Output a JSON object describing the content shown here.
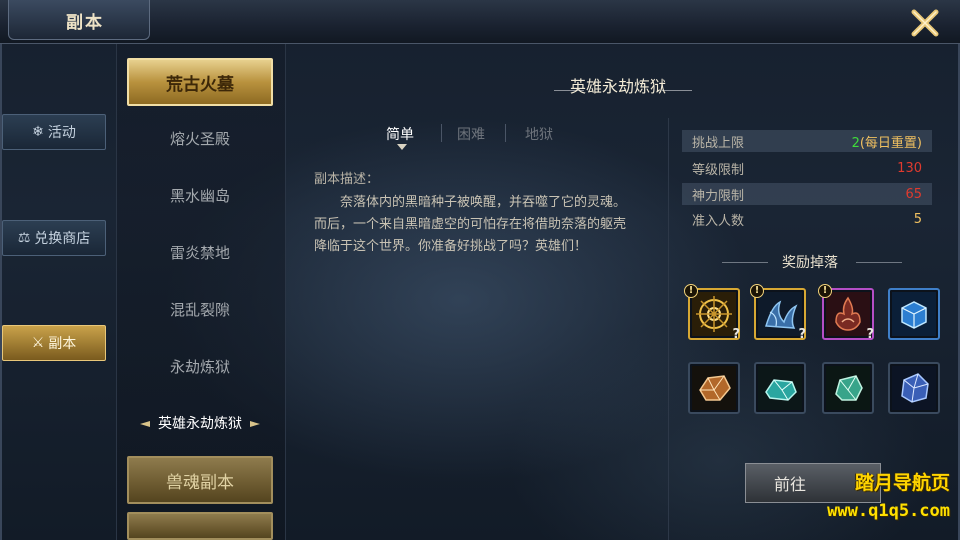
{
  "window": {
    "title": "副本"
  },
  "sidenav": [
    {
      "label": "活动",
      "icon": "snowflake-icon"
    },
    {
      "label": "兑换商店",
      "icon": "scale-icon"
    },
    {
      "label": "副本",
      "icon": "crossed-swords-icon"
    }
  ],
  "categories": [
    {
      "label": "荒古火墓"
    },
    {
      "label": "兽魂副本"
    }
  ],
  "dungeon_list": [
    "熔火圣殿",
    "黑水幽岛",
    "雷炎禁地",
    "混乱裂隙",
    "永劫炼狱",
    "英雄永劫炼狱"
  ],
  "detail": {
    "title": "英雄永劫炼狱",
    "difficulties": [
      "简单",
      "困难",
      "地狱"
    ],
    "desc_title": "副本描述：",
    "desc_body": "奈落体内的黑暗种子被唤醒，并吞噬了它的灵魂。而后，一个来自黑暗虚空的可怕存在将借助奈落的躯壳降临于这个世界。你准备好挑战了吗？英雄们！"
  },
  "stats": [
    {
      "label": "挑战上限",
      "value": "2(每日重置)",
      "value_prefix": "2",
      "value_suffix": "(每日重置)"
    },
    {
      "label": "等级限制",
      "value": "130"
    },
    {
      "label": "神力限制",
      "value": "65"
    },
    {
      "label": "准入人数",
      "value": "5"
    }
  ],
  "rewards": {
    "title": "奖励掉落",
    "badge": "!",
    "qmark": "?"
  },
  "actions": {
    "go_label": "前往"
  },
  "watermark": {
    "line1": "踏月导航页",
    "line2": "www.q1q5.com"
  },
  "colors": {
    "gold": "#d7a833",
    "red_value": "#e03a2e",
    "green_value": "#3fdc3a",
    "yellow_value": "#f0c060"
  }
}
